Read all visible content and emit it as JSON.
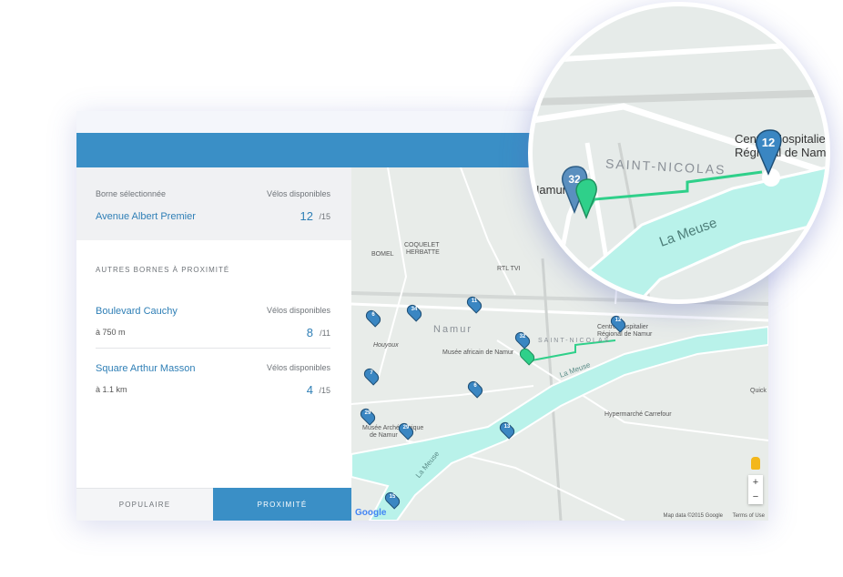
{
  "selected": {
    "heading": "Borne sélectionnée",
    "bikes_label": "Vélos disponibles",
    "name": "Avenue Albert Premier",
    "count": "12",
    "total": "/15"
  },
  "nearby": {
    "title": "AUTRES BORNES À PROXIMITÉ",
    "items": [
      {
        "name": "Boulevard Cauchy",
        "bikes_label": "Vélos disponibles",
        "distance": "à 750 m",
        "count": "8",
        "total": "/11"
      },
      {
        "name": "Square Arthur Masson",
        "bikes_label": "Vélos disponibles",
        "distance": "à 1.1 km",
        "count": "4",
        "total": "/15"
      }
    ]
  },
  "tabs": {
    "popular": "POPULAIRE",
    "proximity": "PROXIMITÉ"
  },
  "map": {
    "labels": {
      "coquelet": "COQUELET",
      "herbatte": "HERBATTE",
      "bomel": "BOMEL",
      "rtl": "RTL TVI",
      "namur": "Namur",
      "houyoux": "Houyoux",
      "musee_africain": "Musée africain de Namur",
      "saint_nicolas": "SAINT-NICOLAS",
      "centre_hosp_1": "Centre Hospitalier",
      "centre_hosp_2": "Régional de Namur",
      "la_meuse_1": "La Meuse",
      "la_meuse_2": "La Meuse",
      "hypermarche": "Hypermarché Carrefour",
      "musee_arch_1": "Musée Archéologique",
      "musee_arch_2": "de Namur",
      "quick": "Quick"
    },
    "markers": [
      "6",
      "34",
      "11",
      "12",
      "32",
      "7",
      "6",
      "29",
      "29",
      "13",
      "15"
    ],
    "google": "Google",
    "map_data": "Map data ©2015 Google",
    "terms": "Terms of Use",
    "zoom_in": "+",
    "zoom_out": "−"
  },
  "magnifier": {
    "namur": "Namur",
    "saint_nicolas": "SAINT-NICOLAS",
    "centre_1": "Centre Hospitalier",
    "centre_2": "Régional de Namur",
    "la_meuse": "La Meuse",
    "marker_32": "32",
    "marker_12": "12"
  },
  "colors": {
    "accent": "#3a8fc6",
    "route": "#2fd08a",
    "river": "#b9f2ea",
    "marker": "#3a86c2"
  }
}
